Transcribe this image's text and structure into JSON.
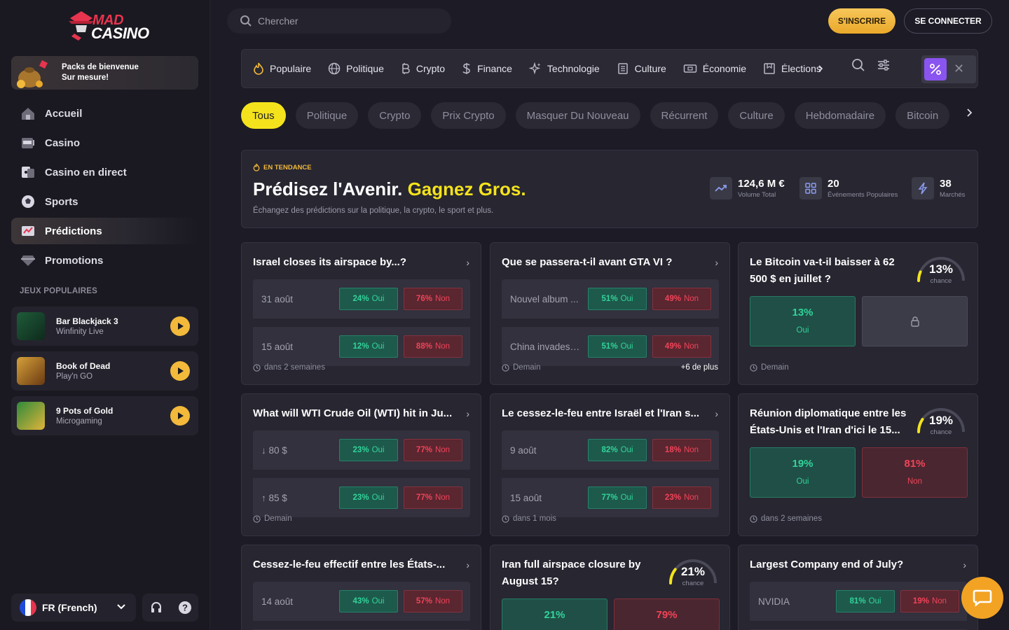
{
  "brand": {
    "line1": "MAD",
    "line2": "CASINO"
  },
  "sidebar": {
    "promo": {
      "line1": "Packs de bienvenue",
      "line2": "Sur mesure!"
    },
    "nav": [
      {
        "label": "Accueil",
        "icon": "home-icon"
      },
      {
        "label": "Casino",
        "icon": "slot-machine-icon"
      },
      {
        "label": "Casino en direct",
        "icon": "live-casino-icon"
      },
      {
        "label": "Sports",
        "icon": "soccer-ball-icon"
      },
      {
        "label": "Prédictions",
        "icon": "predictions-icon"
      },
      {
        "label": "Promotions",
        "icon": "diamond-icon"
      }
    ],
    "section_title": "JEUX POPULAIRES",
    "games": [
      {
        "title": "Bar Blackjack 3",
        "provider": "Winfinity Live"
      },
      {
        "title": "Book of Dead",
        "provider": "Play'n GO"
      },
      {
        "title": "9 Pots of Gold",
        "provider": "Microgaming"
      }
    ],
    "language": "FR (French)"
  },
  "header": {
    "search_placeholder": "Chercher",
    "signup": "S'INSCRIRE",
    "login": "SE CONNECTER"
  },
  "categories": [
    {
      "label": "Populaire",
      "icon": "flame-icon"
    },
    {
      "label": "Politique",
      "icon": "globe-icon"
    },
    {
      "label": "Crypto",
      "icon": "bitcoin-icon"
    },
    {
      "label": "Finance",
      "icon": "dollar-icon"
    },
    {
      "label": "Technologie",
      "icon": "sparkle-icon"
    },
    {
      "label": "Culture",
      "icon": "newspaper-icon"
    },
    {
      "label": "Économie",
      "icon": "banknote-icon"
    },
    {
      "label": "Élections",
      "icon": "ballot-icon"
    }
  ],
  "filters": [
    "Tous",
    "Politique",
    "Crypto",
    "Prix Crypto",
    "Masquer Du Nouveau",
    "Récurrent",
    "Culture",
    "Hebdomadaire",
    "Bitcoin"
  ],
  "hero": {
    "badge": "EN TENDANCE",
    "title_main": "Prédisez l'Avenir.",
    "title_highlight": "Gagnez Gros.",
    "subtitle": "Échangez des prédictions sur la politique, la crypto, le sport et plus.",
    "stats": [
      {
        "value": "124,6 M €",
        "label": "Volume Total"
      },
      {
        "value": "20",
        "label": "Événements Populaires"
      },
      {
        "value": "38",
        "label": "Marchés"
      }
    ]
  },
  "cards": {
    "c1": {
      "title": "Israel closes its airspace by...?",
      "rows": [
        {
          "label": "31 août",
          "yes": "24%",
          "no": "76%"
        },
        {
          "label": "15 août",
          "yes": "12%",
          "no": "88%"
        }
      ],
      "footer": "dans 2 semaines"
    },
    "c2": {
      "title": "Que se passera-t-il avant GTA VI ?",
      "rows": [
        {
          "label": "Nouvel album ...",
          "yes": "51%",
          "no": "49%"
        },
        {
          "label": "China invades ...",
          "yes": "51%",
          "no": "49%"
        }
      ],
      "footer": "Demain",
      "more": "+6 de plus"
    },
    "c3": {
      "title": "Le Bitcoin va-t-il baisser à 62 500 $ en juillet ?",
      "gauge": "13%",
      "gauge_value": 13,
      "yes": "13%",
      "footer": "Demain"
    },
    "c4": {
      "title": "What will WTI Crude Oil (WTI) hit in Ju...",
      "rows": [
        {
          "label": "↓ 80 $",
          "yes": "23%",
          "no": "77%"
        },
        {
          "label": "↑ 85 $",
          "yes": "23%",
          "no": "77%"
        }
      ],
      "footer": "Demain"
    },
    "c5": {
      "title": "Le cessez-le-feu entre Israël et l'Iran s...",
      "rows": [
        {
          "label": "9 août",
          "yes": "82%",
          "no": "18%"
        },
        {
          "label": "15 août",
          "yes": "77%",
          "no": "23%"
        }
      ],
      "footer": "dans 1 mois"
    },
    "c6": {
      "title": "Réunion diplomatique entre les États-Unis et l'Iran d'ici le 15...",
      "gauge": "19%",
      "gauge_value": 19,
      "yes": "19%",
      "no": "81%",
      "footer": "dans 2 semaines"
    },
    "c7": {
      "title": "Cessez-le-feu effectif entre les États-...",
      "rows": [
        {
          "label": "14 août",
          "yes": "43%",
          "no": "57%"
        }
      ]
    },
    "c8": {
      "title": "Iran full airspace closure by August 15?",
      "gauge": "21%",
      "gauge_value": 21,
      "yes": "21%",
      "no": "79%"
    },
    "c9": {
      "title": "Largest Company end of July?",
      "rows": [
        {
          "label": "NVIDIA",
          "yes": "81%",
          "no": "19%"
        }
      ]
    }
  },
  "labels": {
    "yes": "Oui",
    "no": "Non",
    "chance": "chance"
  },
  "colors": {
    "accent_yellow": "#f4e31c",
    "gold": "#f2b93b",
    "purple": "#8a54f0",
    "green": "#33d39a",
    "red": "#f04458"
  }
}
